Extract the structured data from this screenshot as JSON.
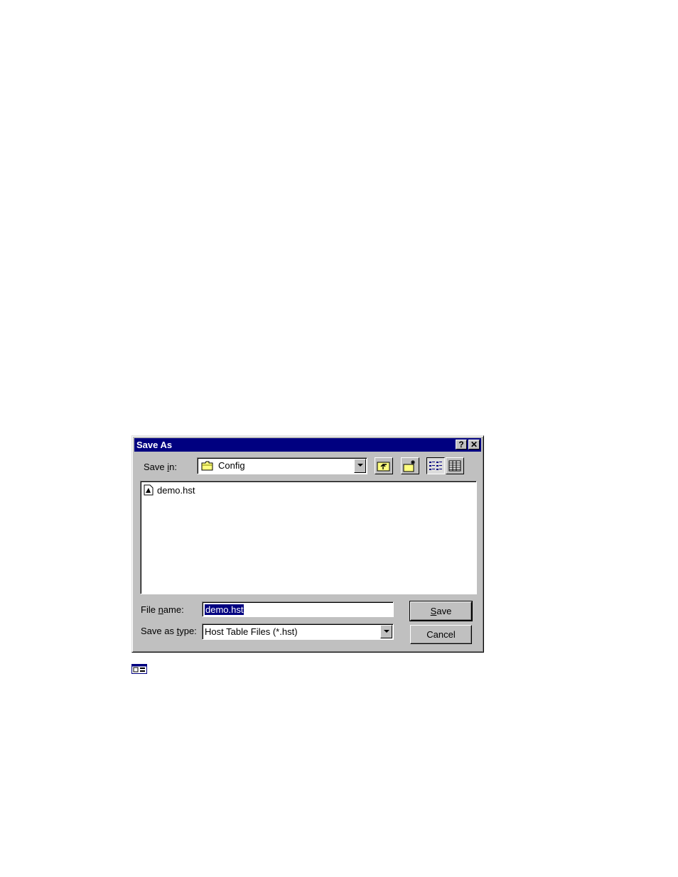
{
  "dialog": {
    "title": "Save As",
    "help_button": "?",
    "close_button": "✕",
    "save_in": {
      "label_pre": "Save ",
      "label_key": "i",
      "label_post": "n:",
      "value": "Config"
    },
    "files": [
      {
        "name": "demo.hst"
      }
    ],
    "file_name": {
      "label_pre": "File ",
      "label_key": "n",
      "label_post": "ame:",
      "value": "demo.hst"
    },
    "save_as_type": {
      "label_pre": "Save as ",
      "label_key": "t",
      "label_post": "ype:",
      "value": "Host Table Files (*.hst)"
    },
    "save_button": {
      "key": "S",
      "rest": "ave"
    },
    "cancel_button": "Cancel"
  },
  "icons": {
    "folder": "folder-icon",
    "up_one_level": "up-folder-icon",
    "new_folder": "new-folder-icon",
    "list_view": "list-view-icon",
    "details_view": "details-view-icon",
    "file": "file-icon",
    "figure_marker": "dialog-thumbnail-icon"
  },
  "colors": {
    "titlebar": "#000080",
    "face": "#c0c0c0",
    "selection": "#000080"
  }
}
